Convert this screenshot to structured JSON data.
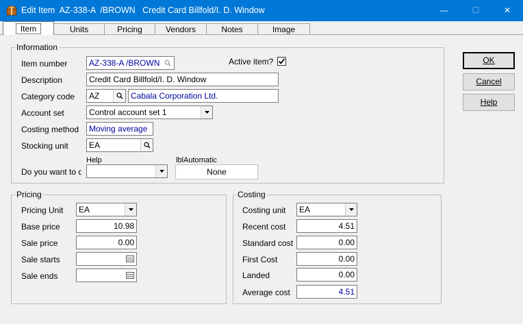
{
  "window": {
    "title": "Edit Item  AZ-338-A  /BROWN   Credit Card Billfold/I. D. Window",
    "minimize_glyph": "—",
    "maximize_glyph": "☐",
    "close_glyph": "✕"
  },
  "tabs": [
    "Item",
    "Units",
    "Pricing",
    "Vendors",
    "Notes",
    "Image"
  ],
  "information": {
    "group_title": "Information",
    "item_number_label": "Item number",
    "item_number_value": "AZ-338-A  /BROWN",
    "active_label": "Active item?",
    "active_checked": true,
    "description_label": "Description",
    "description_value": "Credit Card Billfold/I. D. Window",
    "category_label": "Category code",
    "category_code": "AZ",
    "category_name": "Cabala Corporation Ltd.",
    "account_set_label": "Account set",
    "account_set_value": "Control account set 1",
    "costing_method_label": "Costing method",
    "costing_method_value": "Moving average",
    "stocking_unit_label": "Stocking unit",
    "stocking_unit_value": "EA",
    "help_label": "Help",
    "lbl_automatic": "lblAutomatic",
    "do_you_want_label": "Do you want to de",
    "do_you_want_value": "",
    "none_label": "None"
  },
  "pricing": {
    "group_title": "Pricing",
    "unit_label": "Pricing Unit",
    "unit_value": "EA",
    "base_price_label": "Base price",
    "base_price_value": "10.98",
    "sale_price_label": "Sale price",
    "sale_price_value": "0.00",
    "sale_starts_label": "Sale starts",
    "sale_starts_value": "",
    "sale_ends_label": "Sale ends",
    "sale_ends_value": ""
  },
  "costing": {
    "group_title": "Costing",
    "unit_label": "Costing unit",
    "unit_value": "EA",
    "recent_cost_label": "Recent cost",
    "recent_cost_value": "4.51",
    "standard_cost_label": "Standard cost",
    "standard_cost_value": "0.00",
    "first_cost_label": "First Cost",
    "first_cost_value": "0.00",
    "landed_label": "Landed",
    "landed_value": "0.00",
    "average_cost_label": "Average cost",
    "average_cost_value": "4.51"
  },
  "buttons": {
    "ok": "OK",
    "cancel": "Cancel",
    "help": "Help"
  },
  "icons": {
    "app": "package-icon",
    "lookup": "magnifier-icon",
    "dropdown": "chevron-down-icon",
    "calendar": "calendar-icon"
  }
}
